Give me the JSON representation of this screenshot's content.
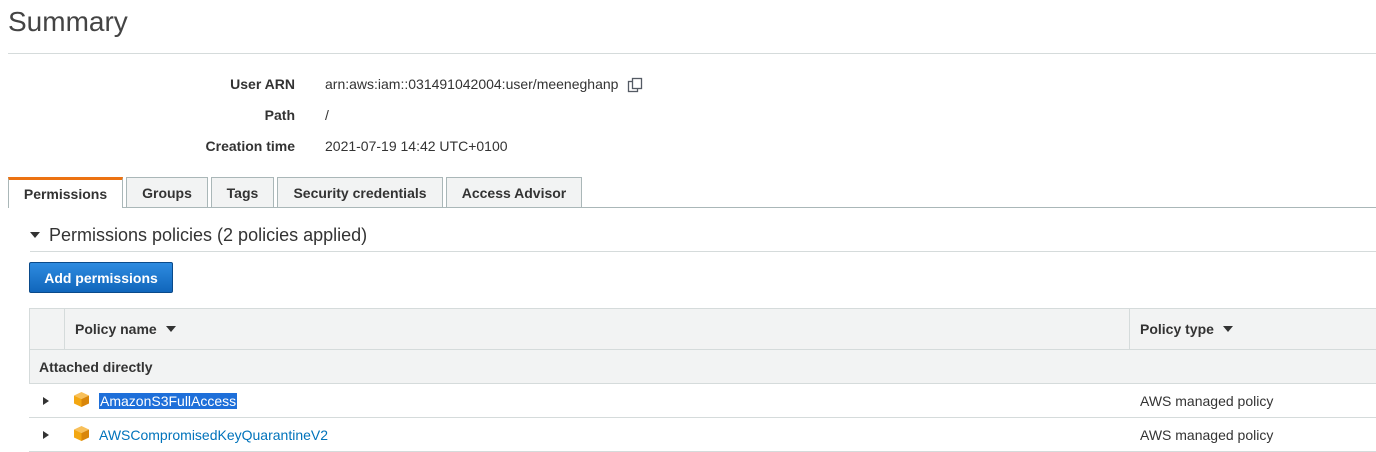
{
  "page": {
    "title": "Summary"
  },
  "summary": {
    "user_arn_label": "User ARN",
    "user_arn_value": "arn:aws:iam::031491042004:user/meeneghanp",
    "path_label": "Path",
    "path_value": "/",
    "creation_label": "Creation time",
    "creation_value": "2021-07-19 14:42 UTC+0100"
  },
  "tabs": [
    {
      "label": "Permissions",
      "active": true
    },
    {
      "label": "Groups",
      "active": false
    },
    {
      "label": "Tags",
      "active": false
    },
    {
      "label": "Security credentials",
      "active": false
    },
    {
      "label": "Access Advisor",
      "active": false
    }
  ],
  "permissions": {
    "section_title": "Permissions policies (2 policies applied)",
    "add_button": "Add permissions",
    "columns": {
      "policy_name": "Policy name",
      "policy_type": "Policy type"
    },
    "group_label": "Attached directly",
    "rows": [
      {
        "name": "AmazonS3FullAccess",
        "type": "AWS managed policy",
        "selected": true
      },
      {
        "name": "AWSCompromisedKeyQuarantineV2",
        "type": "AWS managed policy",
        "selected": false
      }
    ]
  },
  "colors": {
    "accent_tab": "#ec7211",
    "button": "#1166bb",
    "link": "#0073bb",
    "selection": "#1e6fd9",
    "policy_icon": "#f3a712"
  }
}
